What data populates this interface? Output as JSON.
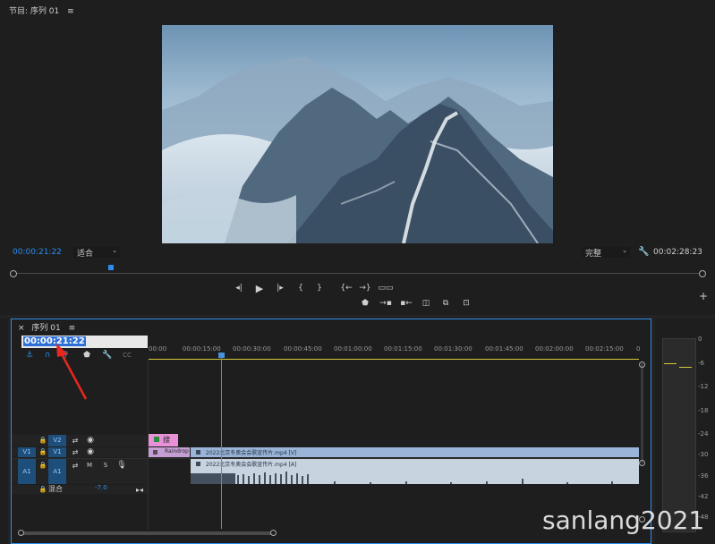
{
  "program_monitor": {
    "tab_title": "节目: 序列 01",
    "menu_glyph": "≡",
    "current_time": "00:00:21:22",
    "fit_select": "适合",
    "quality_select": "完整",
    "duration": "00:02:28:23",
    "video_description": "Snow-covered Great Wall winding over misty mountains",
    "playhead_fraction": 0.147
  },
  "transport": {
    "row1": [
      "mark-in",
      "play",
      "mark-out",
      "go-to-in",
      "go-to-out",
      "step-back",
      "step-forward",
      "export-frame"
    ],
    "row2": [
      "add-marker",
      "insert",
      "overwrite",
      "lift",
      "extract",
      "button-editor",
      "camera"
    ],
    "add_glyph": "+"
  },
  "timeline": {
    "close_glyph": "×",
    "tab_title": "序列 01",
    "menu_glyph": "≡",
    "timecode": "00:00:21:22",
    "ruler_labels": [
      "00:00",
      "00:00:15:00",
      "00:00:30:00",
      "00:00:45:00",
      "00:01:00:00",
      "00:01:15:00",
      "00:01:30:00",
      "00:01:45:00",
      "00:02:00:00",
      "00:02:15:00",
      "0"
    ],
    "tracks": {
      "v2": {
        "target": "V2"
      },
      "v1": {
        "source": "V1",
        "target": "V1"
      },
      "a1": {
        "source": "A1",
        "target": "A1",
        "mute": "M",
        "solo": "S"
      },
      "master": {
        "label": "混合",
        "value": "-7.0"
      }
    },
    "clips": {
      "title_clip": "搜",
      "raindrop": "Raindrop",
      "video_clip": "2022北京冬奥会会歌宣传片.mp4 [V]",
      "audio_clip": "2022北京冬奥会会歌宣传片.mp4 [A]"
    }
  },
  "audio_meter": {
    "db_labels": [
      "0",
      "-6",
      "-12",
      "-18",
      "-24",
      "-30",
      "-36",
      "-42",
      "-48"
    ]
  },
  "watermark": "sanlang2021",
  "colors": {
    "accent": "#2d8ceb",
    "clip_pink": "#e890d8",
    "clip_blue": "#9ab4d8",
    "audio_clip": "#c7d3df",
    "playhead": "#4a90e2",
    "arrow_red": "#e8281e"
  }
}
